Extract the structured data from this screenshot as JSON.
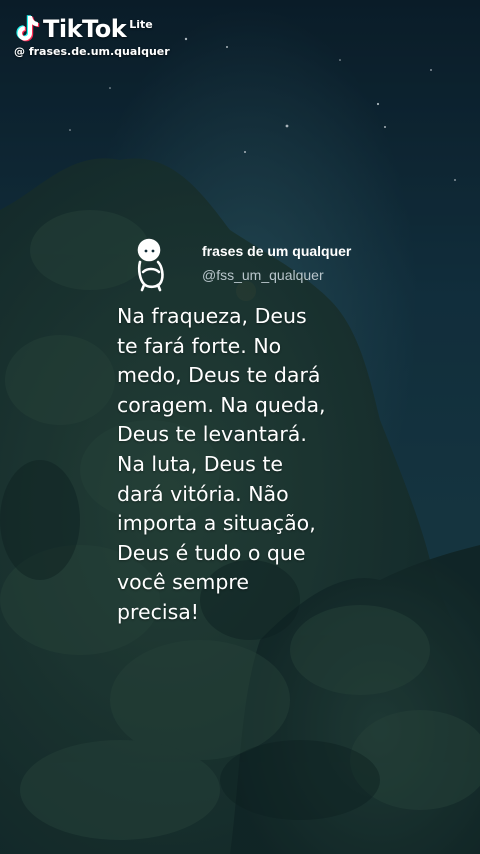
{
  "watermark": {
    "brand": "TikTok",
    "badge": "Lite",
    "handle": "@ frases.de.um.qualquer"
  },
  "post": {
    "author_name": "frases de um qualquer",
    "author_handle": "@fss_um_qualquer",
    "quote_lines": [
      "Na fraqueza, Deus",
      "te fará forte. No",
      "medo, Deus te dará",
      "coragem. Na queda,",
      "Deus te levantará.",
      "Na luta, Deus te",
      "dará vitória. Não",
      "importa a situação,",
      "Deus é tudo o que",
      "você sempre",
      "precisa!"
    ]
  },
  "icons": {
    "brand_logo": "tiktok-note-icon",
    "avatar": "sitting-figure-icon"
  },
  "colors": {
    "sky_top": "#0b1f2c",
    "sky_mid": "#163c4a",
    "foliage": "#1e3b33",
    "text": "#ffffff",
    "handle_text": "#b9c6cc"
  }
}
